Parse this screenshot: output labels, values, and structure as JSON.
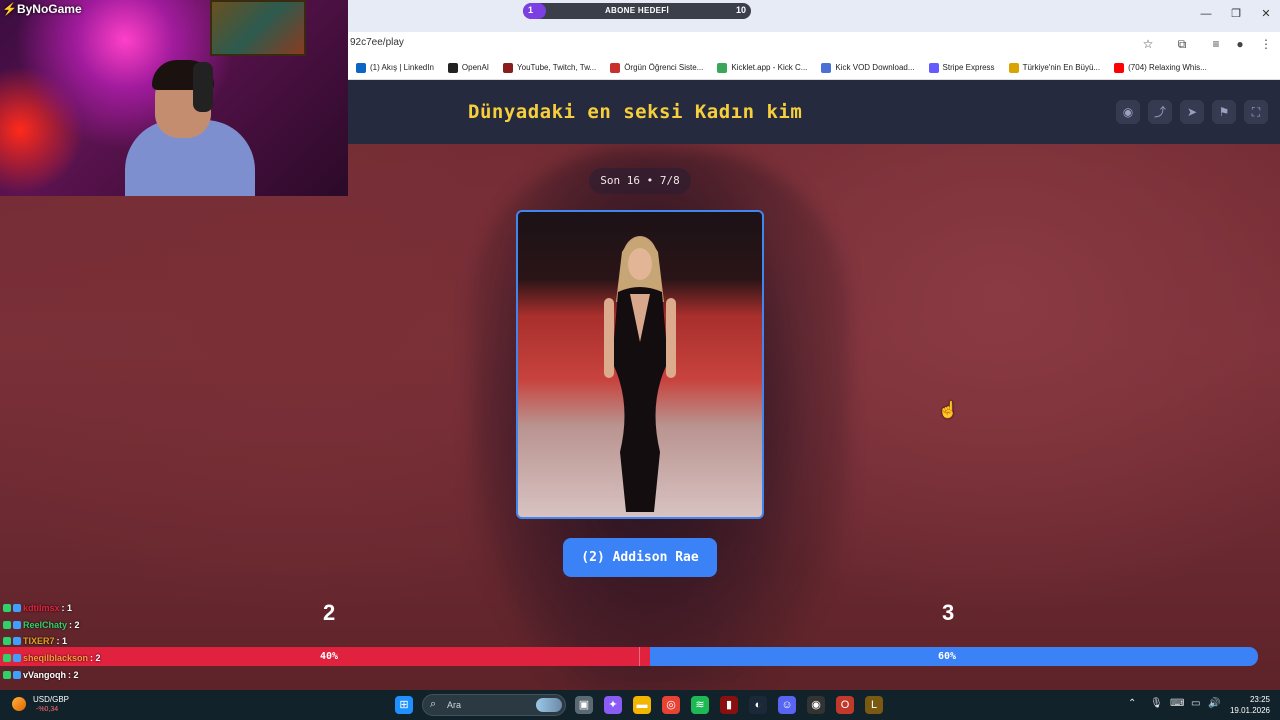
{
  "browser": {
    "goal": {
      "start": "1",
      "label": "ABONE HEDEFİ",
      "end": "10",
      "progress": 0.1
    },
    "url": "92c7ee/play",
    "bookmarks": [
      {
        "label": "(1) Akış | LinkedIn",
        "color": "#0a66c2"
      },
      {
        "label": "OpenAI",
        "color": "#222222"
      },
      {
        "label": "YouTube, Twitch, Tw...",
        "color": "#8a1c1c"
      },
      {
        "label": "Örgün Öğrenci Siste...",
        "color": "#c9302c"
      },
      {
        "label": "Kicklet.app - Kick C...",
        "color": "#3aa65a"
      },
      {
        "label": "Kick VOD Download...",
        "color": "#4a6fd6"
      },
      {
        "label": "Stripe Express",
        "color": "#635bff"
      },
      {
        "label": "Türkiye'nin En Büyü...",
        "color": "#d9a400"
      },
      {
        "label": "(704) Relaxing Whis...",
        "color": "#ff0000"
      }
    ]
  },
  "page": {
    "title": "Dünyadaki en seksi Kadın kim",
    "header_icons": [
      "eye-icon",
      "share-icon",
      "send-icon",
      "flag-icon",
      "fullscreen-icon"
    ]
  },
  "game": {
    "round": "Son 16 • 7/8",
    "candidate_label": "(2) Addison Rae",
    "left_votes": "2",
    "right_votes": "3",
    "left_pct_label": "40%",
    "right_pct_label": "60%",
    "left_share": 0.4,
    "colors": {
      "left": "#e0223f",
      "right": "#3b82f6",
      "title": "#f7cf3c"
    }
  },
  "chat": [
    {
      "user": "kdtilmsx",
      "value": ": 1",
      "color": "#e0223f"
    },
    {
      "user": "ReelChaty",
      "value": ": 2",
      "color": "#2fd16b"
    },
    {
      "user": "TIXER7",
      "value": ": 1",
      "color": "#e0a020"
    },
    {
      "user": "sheqilblackson",
      "value": ": 2",
      "color": "#ff9a3c",
      "highlight": true
    },
    {
      "user": "vVangoqh",
      "value": ": 2",
      "color": "#ffffff"
    }
  ],
  "webcam": {
    "logo": "ByNoGame"
  },
  "taskbar": {
    "ticker_name": "USD/GBP",
    "ticker_value": "-%0,34",
    "search_placeholder": "Ara",
    "time": "23:25",
    "date": "19.01.2026"
  }
}
